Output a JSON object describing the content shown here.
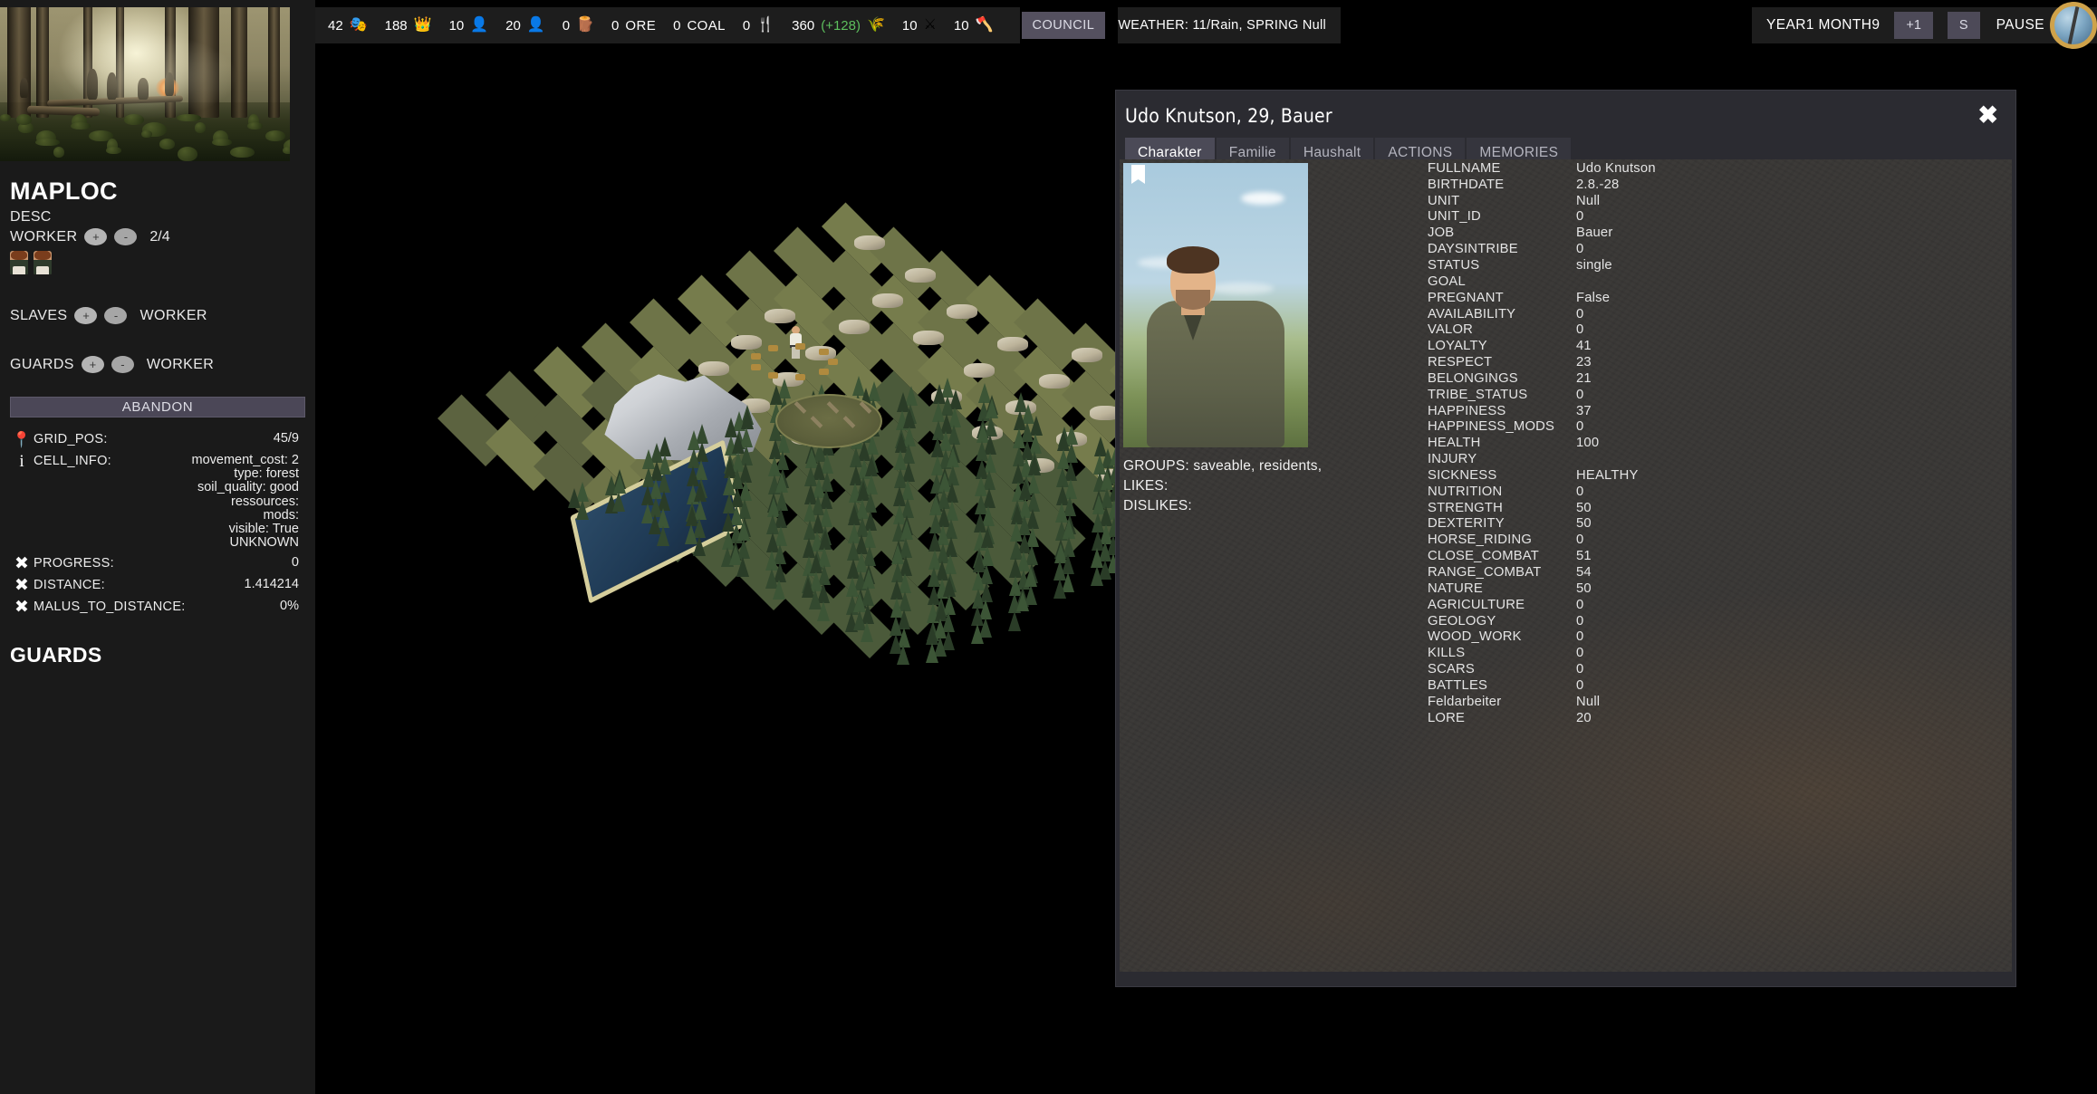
{
  "topbar": {
    "resources": [
      {
        "value": "42",
        "icon": "mask-icon",
        "glyph": "🎭",
        "label": ""
      },
      {
        "value": "188",
        "icon": "crown-icon",
        "glyph": "👑",
        "label": ""
      },
      {
        "value": "10",
        "icon": "unknown-person-icon",
        "glyph": "👤",
        "label": ""
      },
      {
        "value": "20",
        "icon": "person-icon",
        "glyph": "👤",
        "label": ""
      },
      {
        "value": "0",
        "icon": "wood-log-icon",
        "glyph": "🪵",
        "label": ""
      },
      {
        "value": "0",
        "icon": "ore-icon",
        "glyph": "",
        "label": "ORE"
      },
      {
        "value": "0",
        "icon": "coal-icon",
        "glyph": "",
        "label": "COAL"
      },
      {
        "value": "0",
        "icon": "food-icon",
        "glyph": "🍴",
        "label": ""
      },
      {
        "value": "360",
        "icon": "grain-icon",
        "glyph": "🌾",
        "label": "",
        "delta": "(+128)"
      },
      {
        "value": "10",
        "icon": "shield-icon",
        "glyph": "⚔",
        "label": ""
      },
      {
        "value": "10",
        "icon": "axe-icon",
        "glyph": "🪓",
        "label": ""
      }
    ],
    "council_label": "COUNCIL",
    "weather": "WEATHER: 11/Rain, SPRING  Null",
    "date": "YEAR1 MONTH9",
    "speed_up_label": "+1",
    "save_label": "S",
    "pause_label": "PAUSE",
    "accent": "#5dbf5d"
  },
  "sidebar": {
    "title": "MAPLOC",
    "desc": "DESC",
    "worker_row": {
      "label": "WORKER",
      "plus": "+",
      "minus": "-",
      "count": "2/4"
    },
    "slaves_row": {
      "label": "SLAVES",
      "plus": "+",
      "minus": "-",
      "unit": "WORKER"
    },
    "guards_row": {
      "label": "GUARDS",
      "plus": "+",
      "minus": "-",
      "unit": "WORKER"
    },
    "abandon_label": "ABANDON",
    "info": [
      {
        "icon": "map-pin-icon",
        "glyph": "📍",
        "key": "GRID_POS:",
        "value": "45/9"
      },
      {
        "icon": "info-icon",
        "glyph": "i",
        "key": "CELL_INFO:",
        "value": "movement_cost: 2\ntype: forest\nsoil_quality: good\nressources:\nmods:\nvisible: True\nUNKNOWN"
      },
      {
        "icon": "cross-icon",
        "glyph": "✖",
        "key": "PROGRESS:",
        "value": "0"
      },
      {
        "icon": "cross-icon",
        "glyph": "✖",
        "key": "DISTANCE:",
        "value": "1.414214"
      },
      {
        "icon": "cross-icon",
        "glyph": "✖",
        "key": "MALUS_TO_DISTANCE:",
        "value": "0%"
      }
    ],
    "guards_title": "GUARDS"
  },
  "dialog": {
    "title": "Udo Knutson, 29, Bauer",
    "close_glyph": "✖",
    "tabs": [
      {
        "label": "Charakter",
        "active": true
      },
      {
        "label": "Familie",
        "active": false
      },
      {
        "label": "Haushalt",
        "active": false
      },
      {
        "label": "ACTIONS",
        "active": false
      },
      {
        "label": "MEMORIES",
        "active": false
      }
    ],
    "groups_line": "GROUPS: saveable, residents,",
    "likes_line": "LIKES:",
    "dislikes_line": "DISLIKES:",
    "stats": [
      {
        "key": "FULLNAME",
        "value": "Udo Knutson"
      },
      {
        "key": "BIRTHDATE",
        "value": "2.8.-28"
      },
      {
        "key": "UNIT",
        "value": "Null"
      },
      {
        "key": "UNIT_ID",
        "value": "0"
      },
      {
        "key": "JOB",
        "value": "Bauer"
      },
      {
        "key": "DAYSINTRIBE",
        "value": "0"
      },
      {
        "key": "STATUS",
        "value": "single"
      },
      {
        "key": "GOAL",
        "value": ""
      },
      {
        "key": "PREGNANT",
        "value": "False"
      },
      {
        "key": "AVAILABILITY",
        "value": "0"
      },
      {
        "key": "VALOR",
        "value": "0"
      },
      {
        "key": "LOYALTY",
        "value": "41"
      },
      {
        "key": "RESPECT",
        "value": "23"
      },
      {
        "key": "BELONGINGS",
        "value": "21"
      },
      {
        "key": "TRIBE_STATUS",
        "value": "0"
      },
      {
        "key": "HAPPINESS",
        "value": "37"
      },
      {
        "key": "HAPPINESS_MODS",
        "value": "0"
      },
      {
        "key": "HEALTH",
        "value": "100"
      },
      {
        "key": "INJURY",
        "value": ""
      },
      {
        "key": "SICKNESS",
        "value": "HEALTHY"
      },
      {
        "key": "NUTRITION",
        "value": "0"
      },
      {
        "key": "STRENGTH",
        "value": "50"
      },
      {
        "key": "DEXTERITY",
        "value": "50"
      },
      {
        "key": "HORSE_RIDING",
        "value": "0"
      },
      {
        "key": "CLOSE_COMBAT",
        "value": "51"
      },
      {
        "key": "RANGE_COMBAT",
        "value": "54"
      },
      {
        "key": "NATURE",
        "value": "50"
      },
      {
        "key": "AGRICULTURE",
        "value": "0"
      },
      {
        "key": "GEOLOGY",
        "value": "0"
      },
      {
        "key": "WOOD_WORK",
        "value": "0"
      },
      {
        "key": "KILLS",
        "value": "0"
      },
      {
        "key": "SCARS",
        "value": "0"
      },
      {
        "key": "BATTLES",
        "value": "0"
      },
      {
        "key": "Feldarbeiter",
        "value": "Null"
      },
      {
        "key": "LORE",
        "value": "20"
      }
    ]
  }
}
